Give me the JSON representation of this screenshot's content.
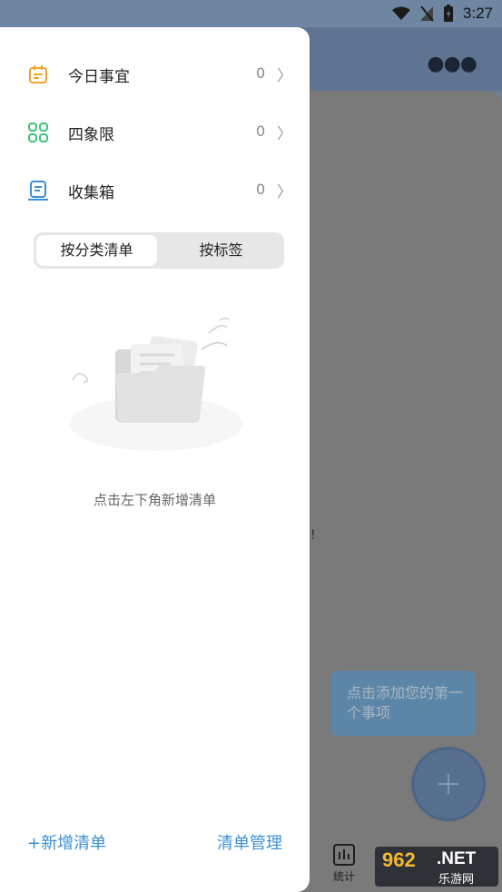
{
  "status_bar": {
    "time": "3:27"
  },
  "drawer": {
    "nav_items": [
      {
        "label": "今日事宜",
        "count": "0",
        "icon": "calendar-icon",
        "color": "#f2a32c"
      },
      {
        "label": "四象限",
        "count": "0",
        "icon": "quadrant-icon",
        "color": "#3cc37a"
      },
      {
        "label": "收集箱",
        "count": "0",
        "icon": "inbox-icon",
        "color": "#3c8fd1"
      }
    ],
    "segment": {
      "active": "按分类清单",
      "inactive": "按标签"
    },
    "empty_text": "点击左下角新增清单",
    "footer": {
      "add": "+新增清单",
      "manage": "清单管理"
    }
  },
  "background": {
    "tooltip": "点击添加您的第一个事项",
    "exclaim": "!",
    "stats_tab": "统计"
  },
  "watermark": {
    "main": "962",
    "net": ".NET",
    "sub": "乐游网"
  },
  "colors": {
    "accent": "#3c8fd1",
    "drawer_bg": "#ffffff",
    "overlay": "#7a7a7a"
  }
}
